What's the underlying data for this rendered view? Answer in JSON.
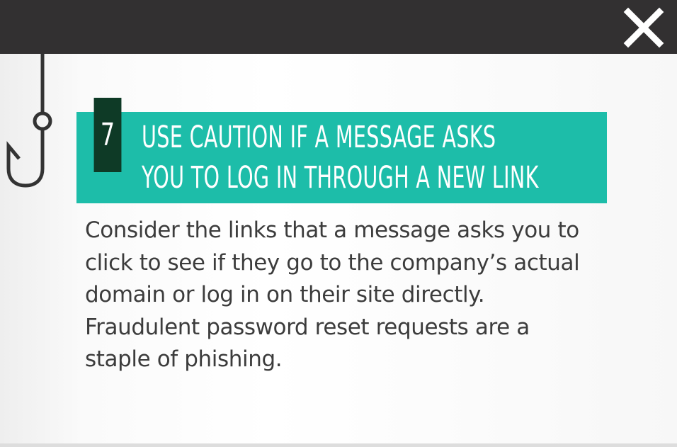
{
  "close_button": {
    "icon": "close-icon"
  },
  "decoration": {
    "icon": "fishing-hook-icon"
  },
  "tip": {
    "number": "7",
    "title_lines": [
      "USE CAUTION IF A MESSAGE ASKS",
      "YOU TO LOG IN THROUGH A NEW LINK"
    ],
    "body_lines": [
      "Consider the links that a message asks you to",
      "click to see if they go to the company’s actual",
      "domain or log in on their site directly.",
      "Fraudulent password reset requests are a",
      "staple of phishing."
    ]
  },
  "colors": {
    "top_bar": "#323031",
    "banner": "#1dbda9",
    "number_box": "#0e3a26",
    "body_text": "#3c3c3c"
  }
}
